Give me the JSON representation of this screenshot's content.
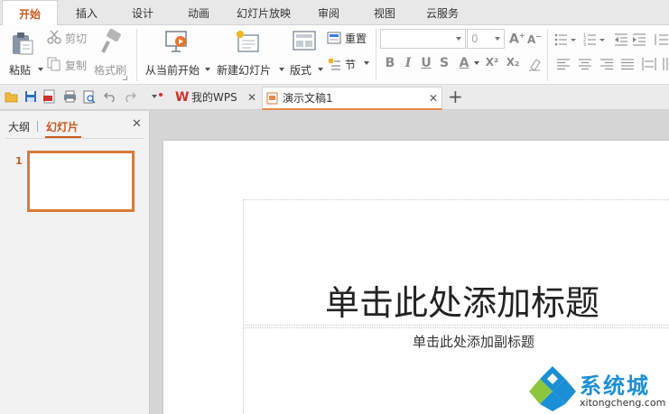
{
  "menu": {
    "tabs": [
      "开始",
      "插入",
      "设计",
      "动画",
      "幻灯片放映",
      "审阅",
      "视图",
      "云服务"
    ],
    "active": "开始"
  },
  "ribbon": {
    "paste": "粘贴",
    "cut": "剪切",
    "copy": "复制",
    "format_painter": "格式刷",
    "from_current": "从当前开始",
    "new_slide": "新建幻灯片",
    "layout": "版式",
    "reset": "重置",
    "section": "节",
    "font_size_value": "0",
    "format_buttons": [
      "B",
      "I",
      "U",
      "S",
      "A",
      "X²",
      "X₂"
    ]
  },
  "tabbar": {
    "my_wps": "我的WPS",
    "doc_tab": "演示文稿1",
    "add_tab": "+"
  },
  "leftpane": {
    "outline_tab": "大纲",
    "slides_tab": "幻灯片",
    "slide_number": "1"
  },
  "slide": {
    "title_placeholder": "单击此处添加标题",
    "subtitle_placeholder": "单击此处添加副标题"
  },
  "watermark": {
    "name": "系统城",
    "site": "xitongcheng.com"
  },
  "colors": {
    "accent": "#c85a1e",
    "thumb_border": "#d97a3b",
    "wps_red": "#d0312d",
    "logo_blue": "#1a8fd6"
  }
}
